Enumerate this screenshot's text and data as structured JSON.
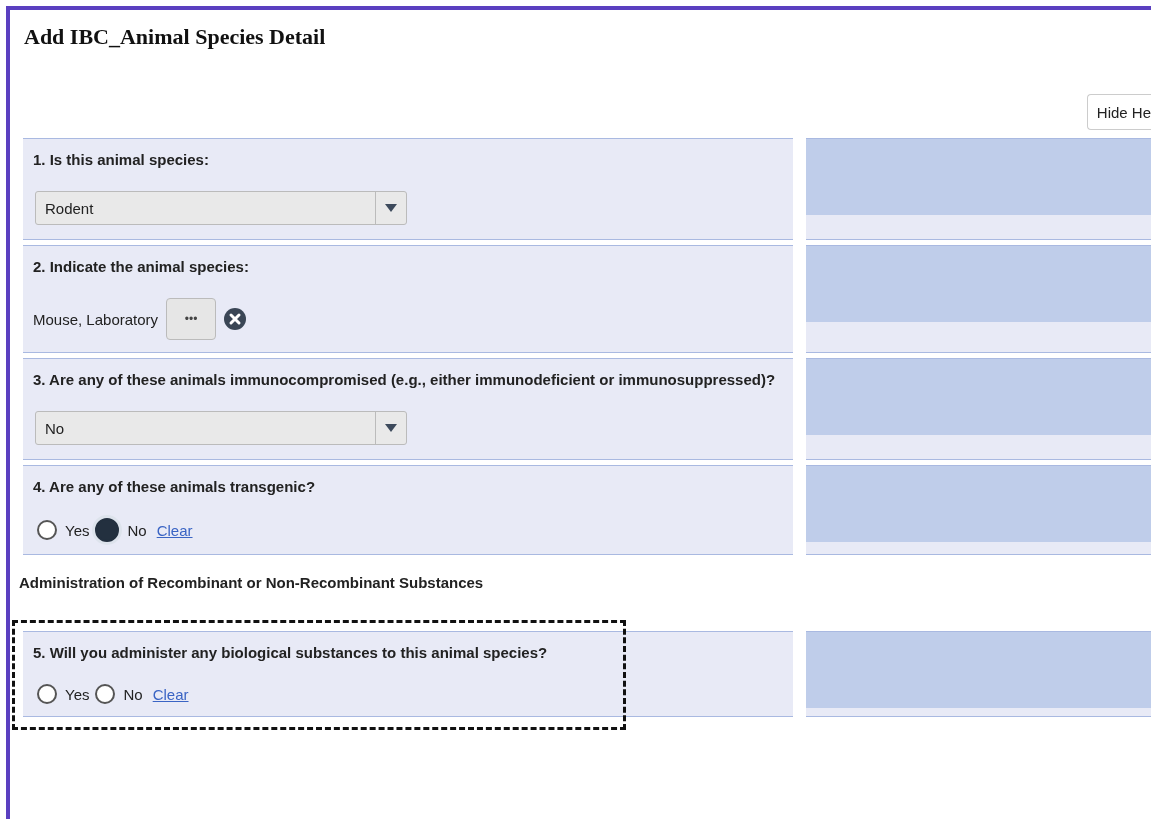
{
  "page_title": "Add IBC_Animal Species Detail",
  "hide_button": "Hide He",
  "sections": [
    {
      "kind": "question",
      "label": "1. Is this animal species:",
      "focused": false,
      "answer": {
        "kind": "select",
        "value": "Rodent"
      }
    },
    {
      "kind": "question",
      "label": "2. Indicate the animal species:",
      "focused": false,
      "answer": {
        "kind": "lookup",
        "value": "Mouse, Laboratory",
        "browse_button": "•••"
      }
    },
    {
      "kind": "question",
      "label": "3. Are any of these animals immunocompromised (e.g., either immunodeficient or immunosuppressed)?",
      "focused": false,
      "answer": {
        "kind": "select",
        "value": "No"
      }
    },
    {
      "kind": "question",
      "label": "4.  Are any of these animals transgenic?",
      "focused": false,
      "answer": {
        "kind": "radio",
        "options": [
          {
            "label": "Yes",
            "selected": false
          },
          {
            "label": "No",
            "selected": true
          }
        ],
        "clear_link": "Clear"
      }
    },
    {
      "kind": "heading",
      "label": "Administration of Recombinant or Non-Recombinant Substances"
    },
    {
      "kind": "question",
      "label": "5.  Will you administer any biological substances to this animal species?",
      "focused": true,
      "answer": {
        "kind": "radio",
        "options": [
          {
            "label": "Yes",
            "selected": false
          },
          {
            "label": "No",
            "selected": false
          }
        ],
        "clear_link": "Clear"
      }
    }
  ]
}
